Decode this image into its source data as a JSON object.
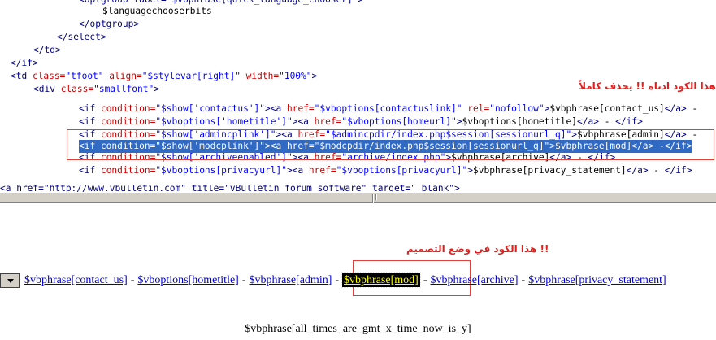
{
  "code_lines": [
    [
      {
        "t": "<optgroup label=\"$vbphrase[quick_language_chooser]\">",
        "c": "tag"
      }
    ],
    [
      {
        "t": "$languagechooserbits",
        "c": "var"
      }
    ],
    [
      {
        "t": "</optgroup>",
        "c": "tag"
      }
    ],
    [
      {
        "t": "</select>",
        "c": "tag"
      }
    ],
    [
      {
        "t": "</td>",
        "c": "tag"
      }
    ],
    [
      {
        "t": "</if>",
        "c": "tag"
      }
    ],
    [
      {
        "t": "<td ",
        "c": "tag"
      },
      {
        "t": "class=",
        "c": "attr"
      },
      {
        "t": "\"tfoot\" ",
        "c": "str"
      },
      {
        "t": "align=",
        "c": "attr"
      },
      {
        "t": "\"$stylevar[right]\" ",
        "c": "str"
      },
      {
        "t": "width=",
        "c": "attr"
      },
      {
        "t": "\"100%\"",
        "c": "str"
      },
      {
        "t": ">",
        "c": "tag"
      }
    ],
    [
      {
        "t": "<div ",
        "c": "tag"
      },
      {
        "t": "class=",
        "c": "attr"
      },
      {
        "t": "\"smallfont\"",
        "c": "str"
      },
      {
        "t": ">",
        "c": "tag"
      }
    ],
    [],
    [
      {
        "t": "<if ",
        "c": "tag"
      },
      {
        "t": "condition=",
        "c": "attr"
      },
      {
        "t": "\"$show['contactus']\"",
        "c": "str"
      },
      {
        "t": "><a ",
        "c": "tag"
      },
      {
        "t": "href=",
        "c": "attr"
      },
      {
        "t": "\"$vboptions[contactuslink]\" ",
        "c": "str"
      },
      {
        "t": "rel=",
        "c": "attr"
      },
      {
        "t": "\"nofollow\"",
        "c": "str"
      },
      {
        "t": ">",
        "c": "tag"
      },
      {
        "t": "$vbphrase[contact_us]",
        "c": "var"
      },
      {
        "t": "</a>",
        "c": "tag"
      },
      {
        "t": " -",
        "c": "var"
      }
    ],
    [
      {
        "t": "<if ",
        "c": "tag"
      },
      {
        "t": "condition=",
        "c": "attr"
      },
      {
        "t": "\"$vboptions['hometitle']\"",
        "c": "str"
      },
      {
        "t": "><a ",
        "c": "tag"
      },
      {
        "t": "href=",
        "c": "attr"
      },
      {
        "t": "\"$vboptions[homeurl]\"",
        "c": "str"
      },
      {
        "t": ">",
        "c": "tag"
      },
      {
        "t": "$vboptions[hometitle]",
        "c": "var"
      },
      {
        "t": "</a>",
        "c": "tag"
      },
      {
        "t": " - ",
        "c": "var"
      },
      {
        "t": "</if>",
        "c": "tag"
      }
    ],
    [
      {
        "t": "<if ",
        "c": "tag"
      },
      {
        "t": "condition=",
        "c": "attr"
      },
      {
        "t": "\"$show['admincplink']\"",
        "c": "str"
      },
      {
        "t": "><a ",
        "c": "tag"
      },
      {
        "t": "href=",
        "c": "attr"
      },
      {
        "t": "\"$admincpdir/index.php$session[sessionurl_q]\"",
        "c": "str"
      },
      {
        "t": ">",
        "c": "tag"
      },
      {
        "t": "$vbphrase[admin]",
        "c": "var"
      },
      {
        "t": "</a>",
        "c": "tag"
      },
      {
        "t": " -",
        "c": "var"
      }
    ],
    [
      {
        "t": "<if condition=\"$show['modcplink']\"><a href=\"$modcpdir/index.php$session[sessionurl_q]\">$vbphrase[mod]</a> -</if>",
        "c": "var"
      }
    ],
    [
      {
        "t": "<if ",
        "c": "tag"
      },
      {
        "t": "condition=",
        "c": "attr"
      },
      {
        "t": "\"$show['archiveenabled']\"",
        "c": "str"
      },
      {
        "t": "><a ",
        "c": "tag"
      },
      {
        "t": "href=",
        "c": "attr"
      },
      {
        "t": "\"archive/index.php\"",
        "c": "str"
      },
      {
        "t": ">",
        "c": "tag"
      },
      {
        "t": "$vbphrase[archive]",
        "c": "var"
      },
      {
        "t": "</a>",
        "c": "tag"
      },
      {
        "t": " - ",
        "c": "var"
      },
      {
        "t": "</if>",
        "c": "tag"
      }
    ],
    [
      {
        "t": "<if ",
        "c": "tag"
      },
      {
        "t": "condition=",
        "c": "attr"
      },
      {
        "t": "\"$vboptions[privacyurl]\"",
        "c": "str"
      },
      {
        "t": "><a ",
        "c": "tag"
      },
      {
        "t": "href=",
        "c": "attr"
      },
      {
        "t": "\"$vboptions[privacyurl]\"",
        "c": "str"
      },
      {
        "t": ">",
        "c": "tag"
      },
      {
        "t": "$vbphrase[privacy_statement]",
        "c": "var"
      },
      {
        "t": "</a>",
        "c": "tag"
      },
      {
        "t": " - ",
        "c": "var"
      },
      {
        "t": "</if>",
        "c": "tag"
      }
    ]
  ],
  "code_cut_line": "<a href=\"http://www.vbulletin.com\" title=\"vBulletin forum software\" target=\"_blank\">",
  "note_code": "هذا الكود ادناه !! يحذف كاملاً",
  "note_design": "!! هذا الكود في وضع التصميم",
  "design_links": {
    "contact_us": "$vbphrase[contact_us]",
    "hometitle": "$vboptions[hometitle]",
    "admin": "$vbphrase[admin]",
    "mod": "$vbphrase[mod]",
    "archive": "$vbphrase[archive]",
    "privacy": "$vbphrase[privacy_statement]",
    "separator": "-"
  },
  "footer_time": "$vbphrase[all_times_are_gmt_x_time_now_is_y]",
  "colors": {
    "tag": "#000080",
    "attr": "#cc0000",
    "str": "#0000ff",
    "selection": "#316ac5",
    "annotation": "#e02020",
    "link": "#0000cc",
    "highlight_bg": "#000000",
    "highlight_fg": "#ffff00"
  }
}
